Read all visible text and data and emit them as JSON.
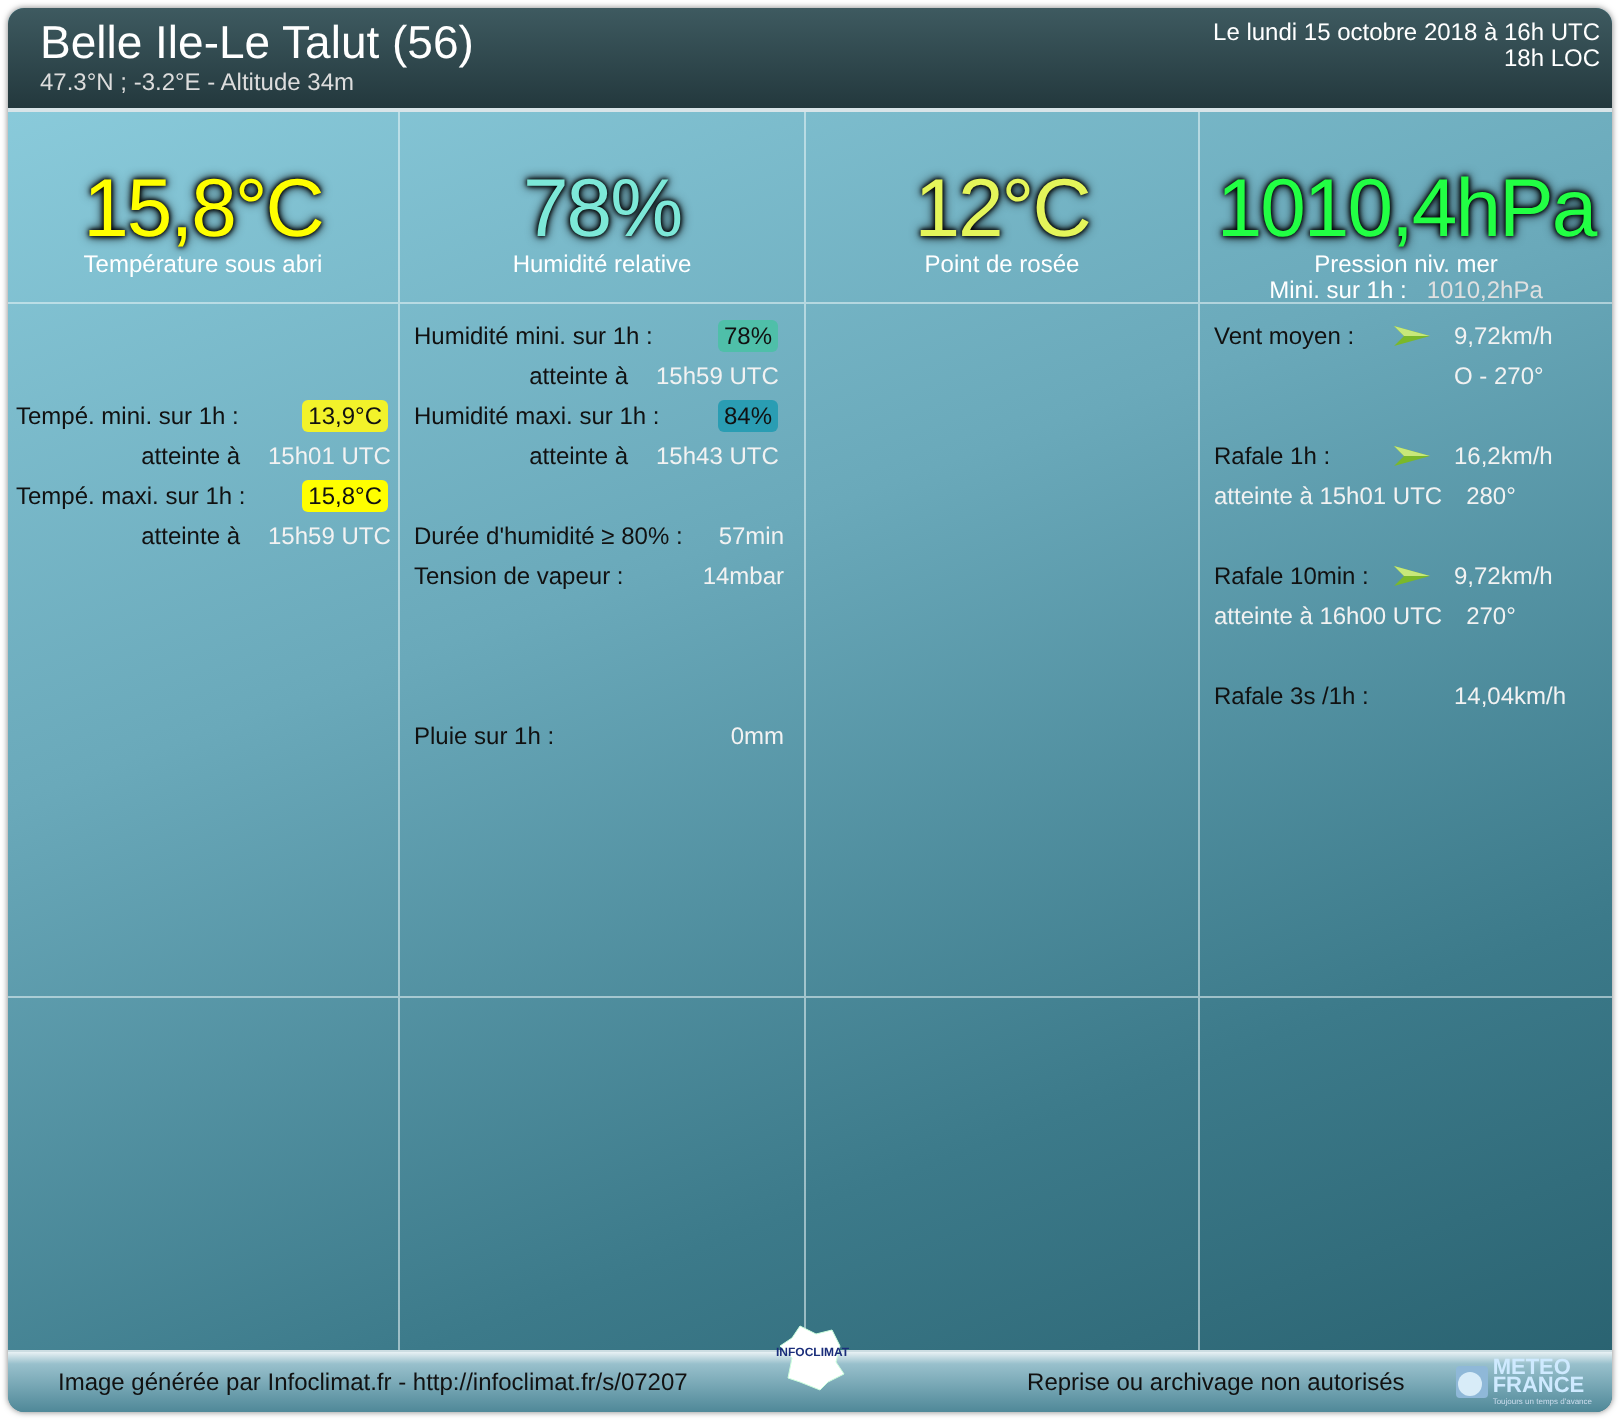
{
  "header": {
    "title": "Belle Ile-Le Talut (56)",
    "subtitle": "47.3°N ; -3.2°E - Altitude 34m",
    "date": "Le lundi 15 octobre 2018 à 16h UTC",
    "local_time": "18h LOC"
  },
  "headlines": [
    {
      "value": "15,8°C",
      "color": "#ffff00",
      "label": "Température sous abri"
    },
    {
      "value": "78%",
      "color": "#7de8d8",
      "label": "Humidité relative"
    },
    {
      "value": "12°C",
      "color": "#e4f55a",
      "label": "Point de rosée"
    },
    {
      "value": "1010,4hPa",
      "color": "#22ff44",
      "label": "Pression niv. mer",
      "extra_label": "Mini. sur 1h :",
      "extra_value": "1010,2hPa"
    }
  ],
  "columns": [
    {
      "kind": "data",
      "groups": [
        [
          {
            "kind": "stat",
            "label": "Tempé. mini. sur 1h :",
            "value": "13,9°C",
            "color": "#f2f22a"
          },
          {
            "kind": "time",
            "label": "atteinte à",
            "value": "15h01 UTC"
          },
          {
            "kind": "stat",
            "label": "Tempé. maxi. sur 1h :",
            "value": "15,8°C",
            "color": "#ffff00"
          },
          {
            "kind": "time",
            "label": "atteinte à",
            "value": "15h59 UTC"
          }
        ]
      ]
    },
    {
      "kind": "data",
      "groups": [
        [
          {
            "kind": "stat",
            "label": "Humidité mini. sur 1h :",
            "value": "78%",
            "color": "#4fbfa9"
          },
          {
            "kind": "time",
            "label": "atteinte à",
            "value": "15h59 UTC"
          },
          {
            "kind": "stat",
            "label": "Humidité maxi. sur 1h :",
            "value": "84%",
            "color": "#2a9db3"
          },
          {
            "kind": "time",
            "label": "atteinte à",
            "value": "15h43 UTC"
          }
        ],
        [
          {
            "kind": "plain",
            "label": "Durée d'humidité ≥ 80% :",
            "value": "57min"
          },
          {
            "kind": "plain",
            "label": "Tension de vapeur :",
            "value": "14mbar"
          }
        ],
        [
          {
            "kind": "plain",
            "label": "Pluie sur 1h :",
            "value": "0mm"
          }
        ]
      ]
    },
    {
      "kind": "empty"
    },
    {
      "kind": "data",
      "groups": [
        [
          {
            "kind": "wind",
            "label": "Vent moyen :",
            "value": "9,72km/h"
          },
          {
            "kind": "indent",
            "value": "O - 270°"
          }
        ],
        [
          {
            "kind": "wind",
            "label": "Rafale 1h :",
            "value": "16,2km/h"
          },
          {
            "kind": "line",
            "value": "atteinte à 15h01 UTC",
            "extra": "280°"
          }
        ],
        [
          {
            "kind": "wind",
            "label": "Rafale 10min :",
            "value": "9,72km/h"
          },
          {
            "kind": "line",
            "value": "atteinte à 16h00 UTC",
            "extra": "270°"
          }
        ],
        [
          {
            "kind": "wind_plain",
            "label": "Rafale 3s /1h :",
            "value": "14,04km/h"
          }
        ]
      ]
    }
  ],
  "footer": {
    "credit": "Image générée par Infoclimat.fr - http://infoclimat.fr/s/07207",
    "notice": "Reprise ou archivage non autorisés",
    "logo_text": "INFOCLIMAT",
    "partner_name": "METEO",
    "partner_name_2": "FRANCE",
    "partner_tagline": "Toujours un temps d'avance"
  }
}
